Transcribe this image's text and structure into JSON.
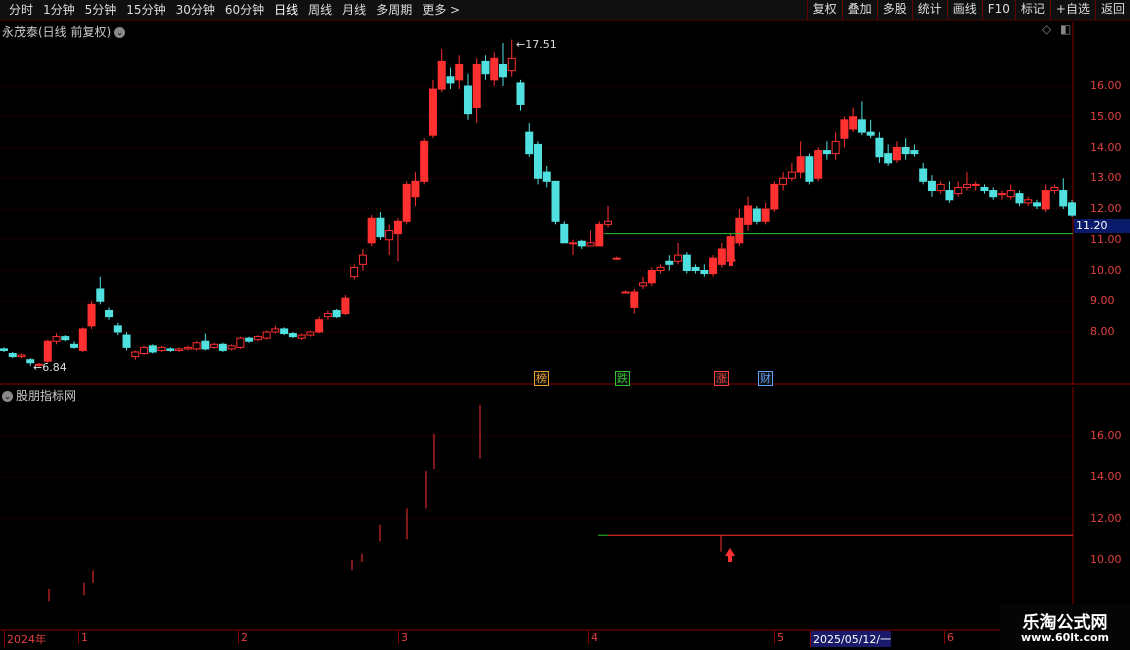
{
  "toolbar": {
    "periods": [
      "分时",
      "1分钟",
      "5分钟",
      "15分钟",
      "30分钟",
      "60分钟",
      "日线",
      "周线",
      "月线",
      "多周期",
      "更多 >"
    ],
    "active_index": 6,
    "actions": [
      "复权",
      "叠加",
      "多股",
      "统计",
      "画线",
      "F10",
      "标记",
      "+自选",
      "返回"
    ]
  },
  "main_title": "永茂泰(日线 前复权)",
  "price_axis": [
    "16.00",
    "15.00",
    "14.00",
    "13.00",
    "12.00",
    "11.00",
    "10.00",
    "9.00",
    "8.00"
  ],
  "current_price": "11.20",
  "high_label": "17.51",
  "low_label": "6.84",
  "event_tags": [
    {
      "text": "榜",
      "color": "#e8a030"
    },
    {
      "text": "跌",
      "color": "#30c030"
    },
    {
      "text": "涨",
      "color": "#ff4040"
    },
    {
      "text": "财",
      "color": "#60a0ff"
    }
  ],
  "indicator_title": "股朋指标网",
  "indicator_axis": [
    "16.00",
    "14.00",
    "12.00",
    "10.00"
  ],
  "date_axis": [
    "2024年",
    "1",
    "2",
    "3",
    "4",
    "5",
    "2025/05/12/一",
    "6"
  ],
  "watermark": {
    "line1": "乐淘公式网",
    "line2": "www.60lt.com"
  },
  "colors": {
    "up": "#ff3030",
    "down": "#50e0e0",
    "grid": "#5a0000",
    "support_line": "#30c030"
  },
  "chart_data": {
    "type": "candlestick",
    "ylim": [
      6.5,
      18.0
    ],
    "support_level": 11.2,
    "candles": [
      [
        7.45,
        7.4,
        7.5,
        7.35
      ],
      [
        7.3,
        7.2,
        7.35,
        7.15
      ],
      [
        7.2,
        7.25,
        7.3,
        7.15
      ],
      [
        7.1,
        7.0,
        7.15,
        6.9
      ],
      [
        6.95,
        6.95,
        7.0,
        6.84
      ],
      [
        7.05,
        7.7,
        7.75,
        7.0
      ],
      [
        7.7,
        7.85,
        7.95,
        7.6
      ],
      [
        7.85,
        7.75,
        7.9,
        7.7
      ],
      [
        7.6,
        7.5,
        7.7,
        7.45
      ],
      [
        7.4,
        8.1,
        8.15,
        7.35
      ],
      [
        8.2,
        8.9,
        9.0,
        8.1
      ],
      [
        9.4,
        9.0,
        9.8,
        8.9
      ],
      [
        8.7,
        8.5,
        8.8,
        8.4
      ],
      [
        8.2,
        8.0,
        8.3,
        7.9
      ],
      [
        7.9,
        7.5,
        8.0,
        7.4
      ],
      [
        7.2,
        7.35,
        7.4,
        7.1
      ],
      [
        7.3,
        7.5,
        7.55,
        7.25
      ],
      [
        7.55,
        7.35,
        7.6,
        7.3
      ],
      [
        7.4,
        7.5,
        7.55,
        7.35
      ],
      [
        7.45,
        7.4,
        7.5,
        7.35
      ],
      [
        7.4,
        7.45,
        7.5,
        7.35
      ],
      [
        7.45,
        7.5,
        7.55,
        7.4
      ],
      [
        7.45,
        7.65,
        7.7,
        7.4
      ],
      [
        7.7,
        7.45,
        7.95,
        7.4
      ],
      [
        7.5,
        7.6,
        7.65,
        7.45
      ],
      [
        7.6,
        7.4,
        7.65,
        7.35
      ],
      [
        7.45,
        7.55,
        7.6,
        7.4
      ],
      [
        7.5,
        7.8,
        7.85,
        7.45
      ],
      [
        7.8,
        7.7,
        7.85,
        7.65
      ],
      [
        7.75,
        7.85,
        7.9,
        7.7
      ],
      [
        7.8,
        8.0,
        8.05,
        7.75
      ],
      [
        8.0,
        8.1,
        8.2,
        7.95
      ],
      [
        8.1,
        7.95,
        8.15,
        7.9
      ],
      [
        7.95,
        7.85,
        8.0,
        7.8
      ],
      [
        7.8,
        7.9,
        7.95,
        7.75
      ],
      [
        7.9,
        8.0,
        8.05,
        7.85
      ],
      [
        8.0,
        8.4,
        8.5,
        7.95
      ],
      [
        8.5,
        8.6,
        8.7,
        8.4
      ],
      [
        8.7,
        8.5,
        8.75,
        8.45
      ],
      [
        8.6,
        9.1,
        9.2,
        8.55
      ],
      [
        9.8,
        10.1,
        10.2,
        9.7
      ],
      [
        10.2,
        10.5,
        10.7,
        10.0
      ],
      [
        10.9,
        11.7,
        11.8,
        10.8
      ],
      [
        11.7,
        11.1,
        11.9,
        11.0
      ],
      [
        11.0,
        11.3,
        11.5,
        10.5
      ],
      [
        11.2,
        11.6,
        11.7,
        10.3
      ],
      [
        11.6,
        12.8,
        12.9,
        11.5
      ],
      [
        12.4,
        12.9,
        13.2,
        12.1
      ],
      [
        12.9,
        14.2,
        14.3,
        12.8
      ],
      [
        14.4,
        15.9,
        16.2,
        14.3
      ],
      [
        15.9,
        16.8,
        17.2,
        15.8
      ],
      [
        16.3,
        16.1,
        16.6,
        15.9
      ],
      [
        16.2,
        16.7,
        17.0,
        15.9
      ],
      [
        16.0,
        15.1,
        16.4,
        14.9
      ],
      [
        15.3,
        16.7,
        16.9,
        14.8
      ],
      [
        16.8,
        16.4,
        17.0,
        16.2
      ],
      [
        16.2,
        16.9,
        17.1,
        16.0
      ],
      [
        16.7,
        16.3,
        17.4,
        16.0
      ],
      [
        16.5,
        16.9,
        17.51,
        16.3
      ],
      [
        16.1,
        15.4,
        16.2,
        15.2
      ],
      [
        14.5,
        13.8,
        14.8,
        13.7
      ],
      [
        14.1,
        13.0,
        14.2,
        12.8
      ],
      [
        13.2,
        12.9,
        13.4,
        12.7
      ],
      [
        12.9,
        11.6,
        12.9,
        11.5
      ],
      [
        11.5,
        10.9,
        11.6,
        10.9
      ],
      [
        10.9,
        10.9,
        11.0,
        10.5
      ],
      [
        10.95,
        10.8,
        11.0,
        10.7
      ],
      [
        10.8,
        10.9,
        11.3,
        10.8
      ],
      [
        10.8,
        11.5,
        11.6,
        10.8
      ],
      [
        11.5,
        11.6,
        12.1,
        11.4
      ],
      [
        10.4,
        10.4,
        10.45,
        10.35
      ],
      [
        9.3,
        9.3,
        9.35,
        9.25
      ],
      [
        8.8,
        9.3,
        9.4,
        8.6
      ],
      [
        9.5,
        9.6,
        9.8,
        9.4
      ],
      [
        9.6,
        10.0,
        10.1,
        9.5
      ],
      [
        10.0,
        10.1,
        10.2,
        9.9
      ],
      [
        10.3,
        10.2,
        10.5,
        10.0
      ],
      [
        10.3,
        10.5,
        10.9,
        10.2
      ],
      [
        10.5,
        10.0,
        10.6,
        9.9
      ],
      [
        10.1,
        10.0,
        10.2,
        9.9
      ],
      [
        10.0,
        9.9,
        10.2,
        9.8
      ],
      [
        9.9,
        10.4,
        10.5,
        9.8
      ],
      [
        10.2,
        10.7,
        10.9,
        10.1
      ],
      [
        10.3,
        11.1,
        11.2,
        10.2
      ],
      [
        10.9,
        11.7,
        12.0,
        10.8
      ],
      [
        11.5,
        12.1,
        12.4,
        11.3
      ],
      [
        12.0,
        11.6,
        12.1,
        11.5
      ],
      [
        11.6,
        12.0,
        12.2,
        11.5
      ],
      [
        12.0,
        12.8,
        12.9,
        11.9
      ],
      [
        12.8,
        13.0,
        13.2,
        12.6
      ],
      [
        13.0,
        13.2,
        13.5,
        12.9
      ],
      [
        13.2,
        13.7,
        14.2,
        13.0
      ],
      [
        13.7,
        12.9,
        13.8,
        12.8
      ],
      [
        13.0,
        13.9,
        14.0,
        12.9
      ],
      [
        13.9,
        13.8,
        14.2,
        13.6
      ],
      [
        13.8,
        14.2,
        14.5,
        13.6
      ],
      [
        14.3,
        14.9,
        15.0,
        14.0
      ],
      [
        14.6,
        15.0,
        15.3,
        14.5
      ],
      [
        14.9,
        14.5,
        15.5,
        14.4
      ],
      [
        14.5,
        14.4,
        14.9,
        14.3
      ],
      [
        14.3,
        13.7,
        14.5,
        13.5
      ],
      [
        13.8,
        13.5,
        14.1,
        13.4
      ],
      [
        13.6,
        14.0,
        14.2,
        13.5
      ],
      [
        14.0,
        13.8,
        14.3,
        13.6
      ],
      [
        13.9,
        13.8,
        14.1,
        13.7
      ],
      [
        13.3,
        12.9,
        13.5,
        12.8
      ],
      [
        12.9,
        12.6,
        13.1,
        12.4
      ],
      [
        12.6,
        12.8,
        12.9,
        12.5
      ],
      [
        12.6,
        12.3,
        12.9,
        12.2
      ],
      [
        12.5,
        12.7,
        12.9,
        12.4
      ],
      [
        12.7,
        12.8,
        13.2,
        12.6
      ],
      [
        12.8,
        12.8,
        12.9,
        12.6
      ],
      [
        12.7,
        12.6,
        12.8,
        12.5
      ],
      [
        12.6,
        12.4,
        12.7,
        12.3
      ],
      [
        12.5,
        12.5,
        12.6,
        12.3
      ],
      [
        12.4,
        12.6,
        12.8,
        12.3
      ],
      [
        12.5,
        12.2,
        12.6,
        12.1
      ],
      [
        12.2,
        12.3,
        12.4,
        12.1
      ],
      [
        12.2,
        12.1,
        12.3,
        12.0
      ],
      [
        12.0,
        12.6,
        12.8,
        11.9
      ],
      [
        12.6,
        12.7,
        12.8,
        12.5
      ],
      [
        12.6,
        12.1,
        13.0,
        12.0
      ],
      [
        12.2,
        11.8,
        12.3,
        11.75
      ]
    ],
    "indicator_marks": [
      [
        8.0,
        8.6
      ],
      [
        8.3,
        8.9
      ],
      [
        8.9,
        9.5
      ],
      [
        9.5,
        10.0
      ],
      [
        9.9,
        10.3
      ],
      [
        10.9,
        11.7
      ],
      [
        11.0,
        12.5
      ],
      [
        12.5,
        14.3
      ],
      [
        14.4,
        16.1
      ],
      [
        14.9,
        16.3
      ],
      [
        16.3,
        17.5
      ]
    ]
  }
}
